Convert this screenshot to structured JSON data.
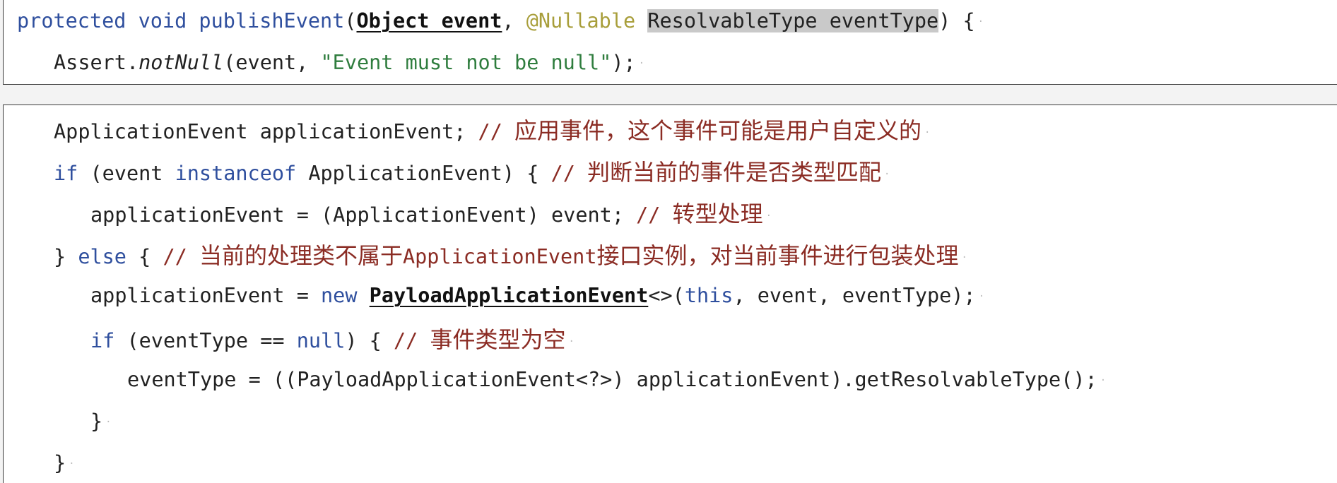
{
  "code": {
    "l1": {
      "kw1": "protected",
      "kw2": "void",
      "name": "publishEvent",
      "paren_open": "(",
      "param1": "Object event",
      "comma": ", ",
      "annotation": "@Nullable",
      "space": " ",
      "param2": "ResolvableType eventType",
      "tail": ") {"
    },
    "l2": {
      "a": "Assert.",
      "method": "notNull",
      "b": "(event, ",
      "str": "\"Event must not be null\"",
      "c": ");"
    },
    "l3": {
      "code": "ApplicationEvent applicationEvent; ",
      "comment_prefix": "// ",
      "comment": "应用事件，这个事件可能是用户自定义的"
    },
    "l4": {
      "kw": "if",
      "a": " (event ",
      "kw2": "instanceof",
      "b": " ApplicationEvent) { ",
      "comment_prefix": "// ",
      "comment": "判断当前的事件是否类型匹配"
    },
    "l5": {
      "code": "applicationEvent = (ApplicationEvent) event; ",
      "comment_prefix": "// ",
      "comment": "转型处理"
    },
    "l6": {
      "a": "} ",
      "kw": "else",
      "b": " { ",
      "comment_prefix": "// ",
      "comment_zh1": "当前的处理类不属于",
      "comment_en": "ApplicationEvent",
      "comment_zh2": "接口实例，对当前事件进行包装处理"
    },
    "l7": {
      "a": "applicationEvent = ",
      "kw": "new",
      "space": " ",
      "cls": "PayloadApplicationEvent",
      "b": "<>(",
      "kw2": "this",
      "c": ", event, eventType);"
    },
    "l8": {
      "kw": "if",
      "a": " (eventType == ",
      "kw2": "null",
      "b": ") { ",
      "comment_prefix": "// ",
      "comment": "事件类型为空"
    },
    "l9": {
      "code": "eventType = ((PayloadApplicationEvent<?>) applicationEvent).getResolvableType();"
    },
    "l10": {
      "code": "}"
    },
    "l11": {
      "code": "}"
    }
  },
  "colors": {
    "keyword": "#2f4f9e",
    "annotation": "#a89e3a",
    "string": "#2f7d3e",
    "comment": "#8b2c24",
    "selection": "#c9c9c9"
  }
}
